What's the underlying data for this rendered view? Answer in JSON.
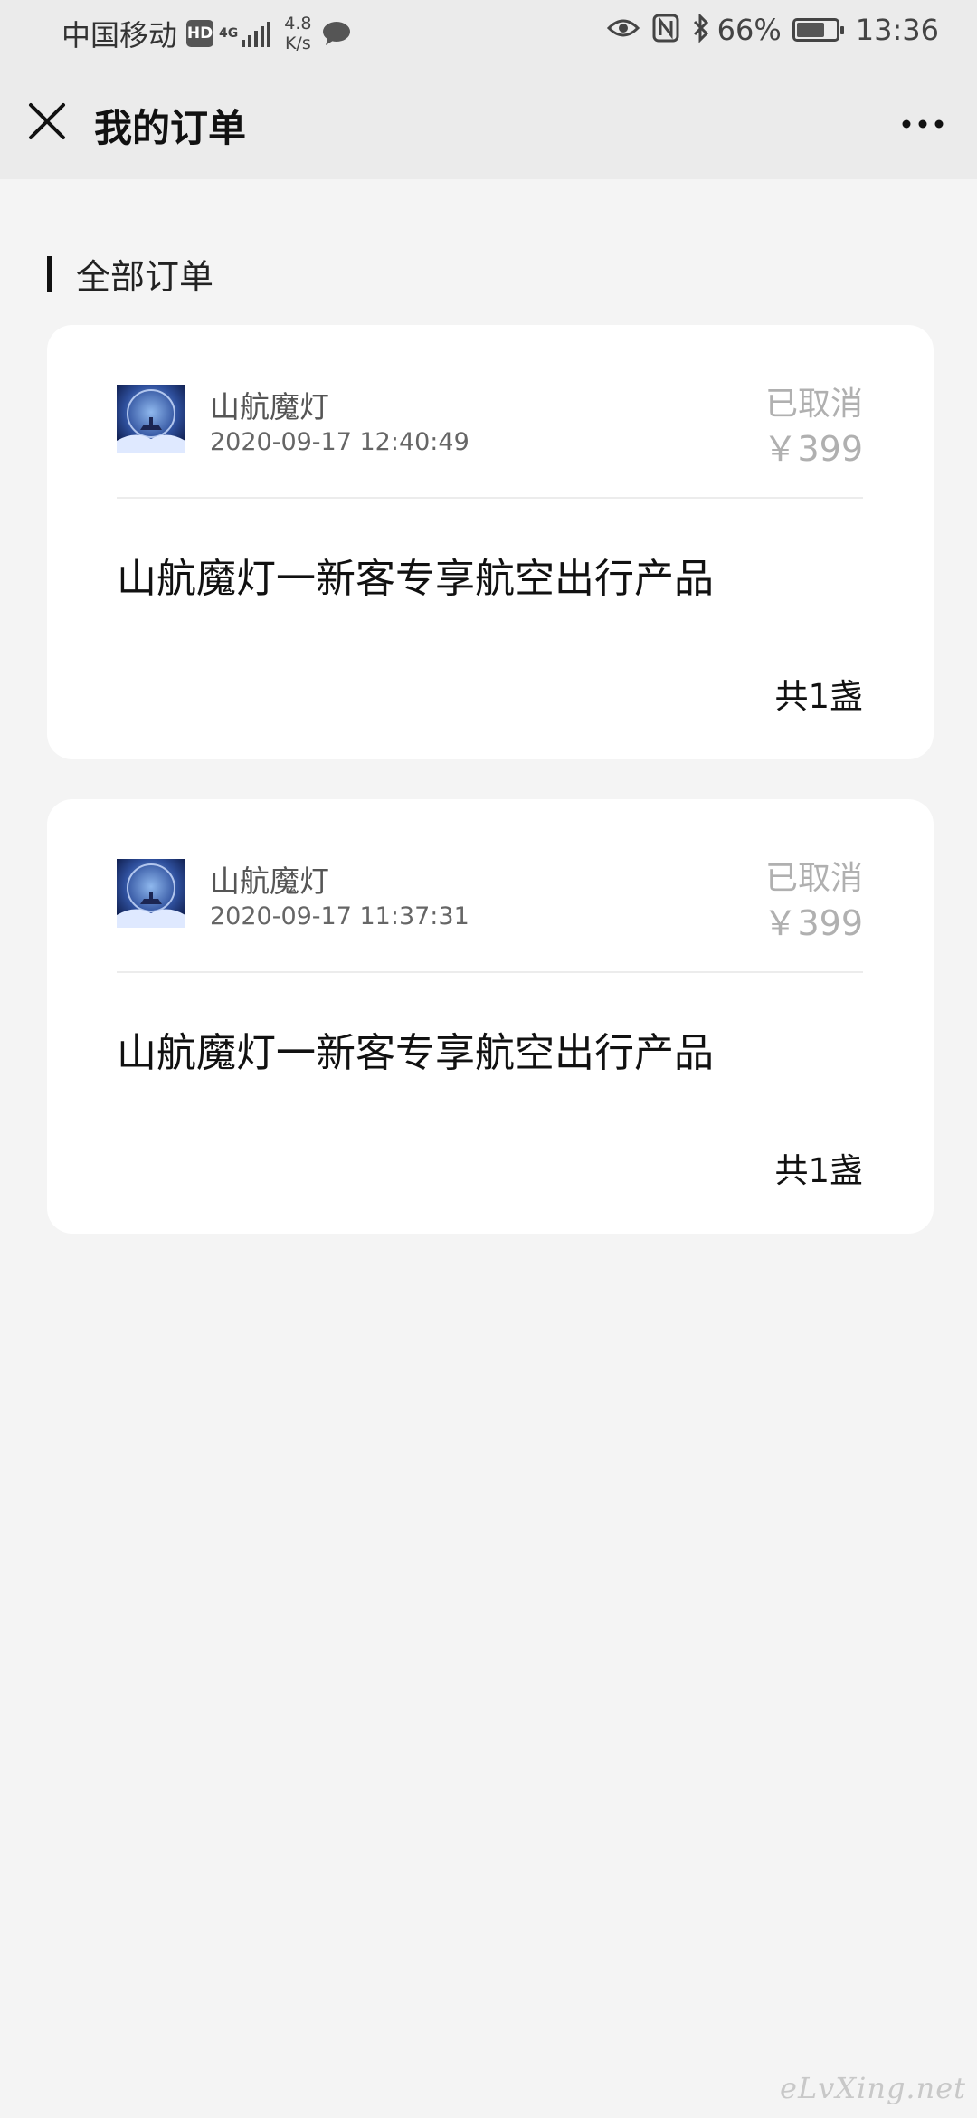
{
  "status_bar": {
    "carrier": "中国移动",
    "hd_badge": "HD",
    "network_gen": "4G",
    "speed_value": "4.8",
    "speed_unit": "K/s",
    "battery_percent": "66%",
    "battery_level": 0.66,
    "time": "13:36",
    "icons": [
      "chat-icon",
      "eye-icon",
      "nfc-icon",
      "bluetooth-icon",
      "battery-icon"
    ]
  },
  "header": {
    "title": "我的订单",
    "close_icon": "close-icon",
    "more_icon": "more-icon"
  },
  "section": {
    "title": "全部订单"
  },
  "orders": [
    {
      "shop_name": "山航魔灯",
      "time": "2020-09-17 12:40:49",
      "status": "已取消",
      "price": "￥399",
      "product": "山航魔灯一新客专享航空出行产品",
      "count": "共1盏"
    },
    {
      "shop_name": "山航魔灯",
      "time": "2020-09-17 11:37:31",
      "status": "已取消",
      "price": "￥399",
      "product": "山航魔灯一新客专享航空出行产品",
      "count": "共1盏"
    }
  ],
  "watermark": "eLvXing.net",
  "colors": {
    "bar_bg": "#ebebeb",
    "page_bg": "#f4f4f4",
    "muted_text": "#b0b0b0"
  }
}
